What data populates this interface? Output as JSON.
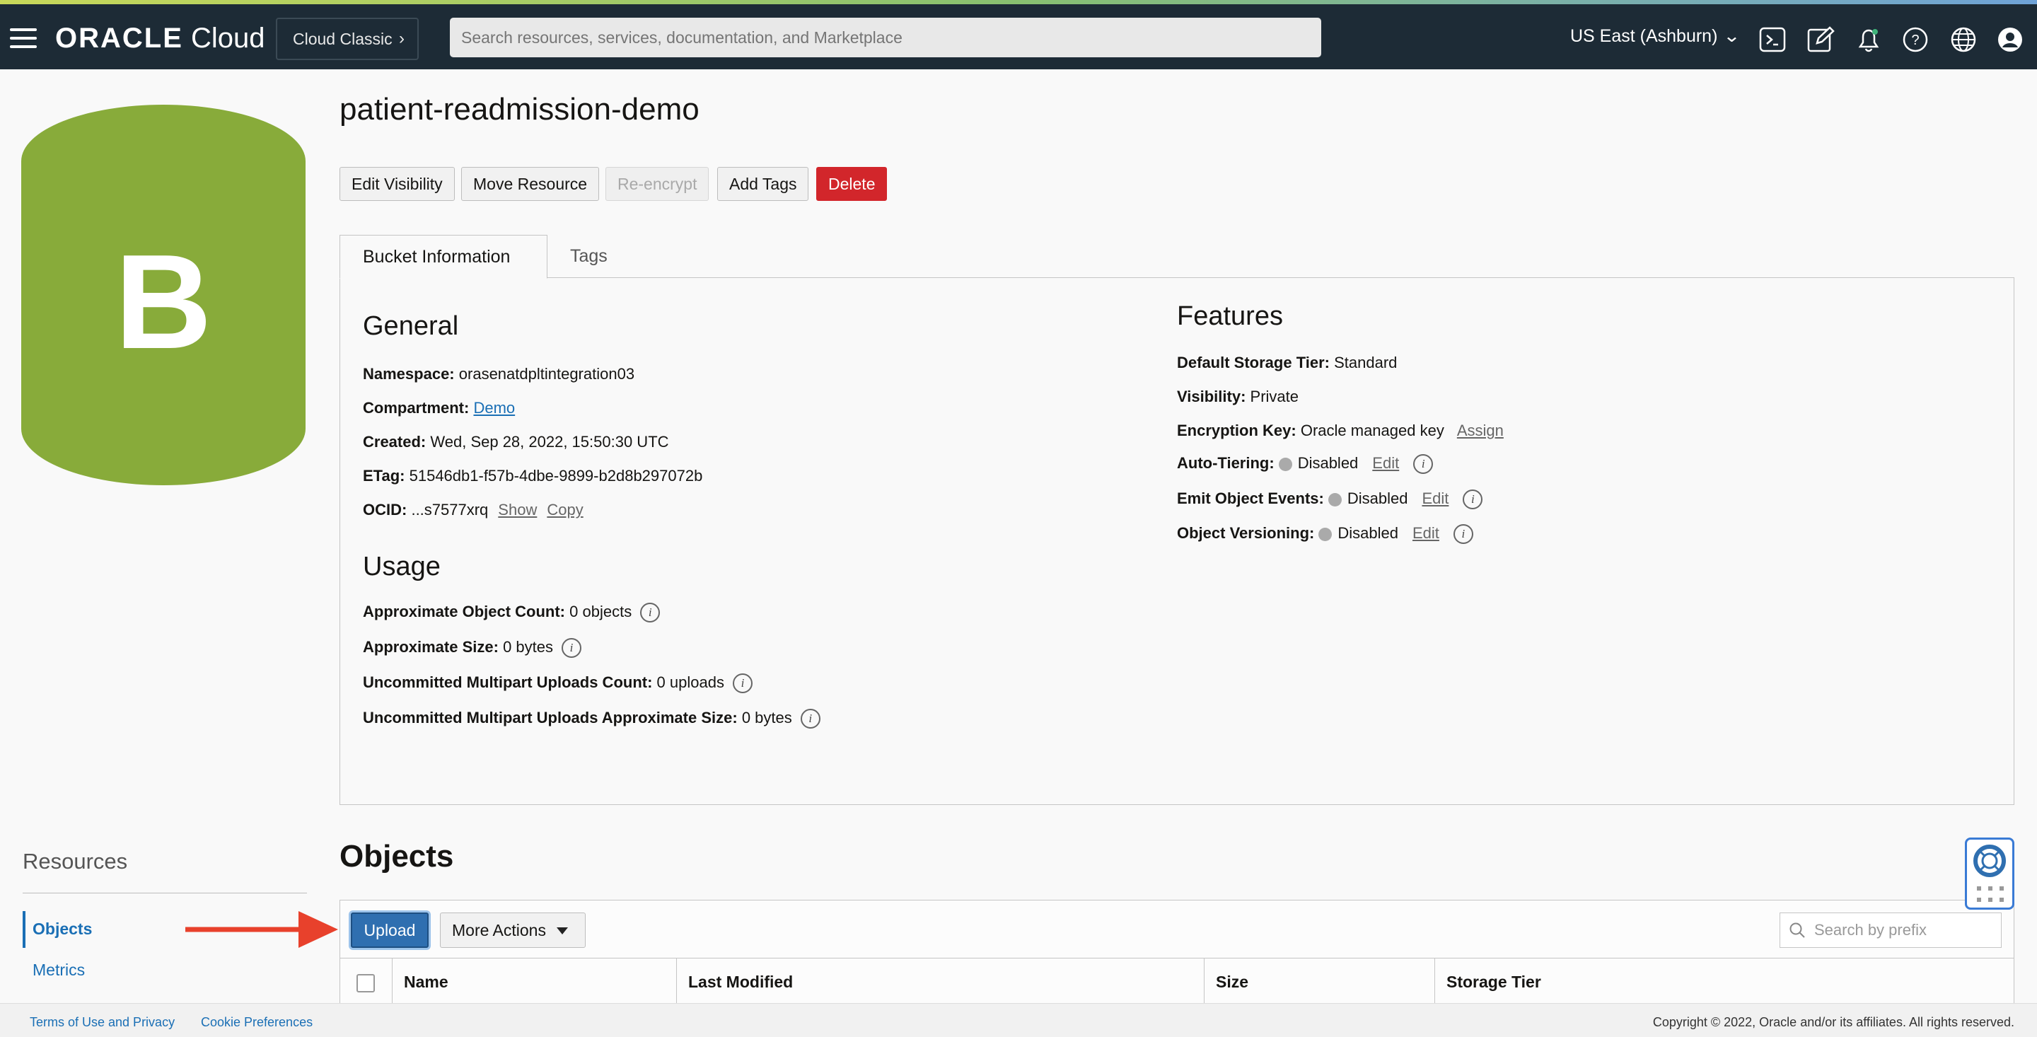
{
  "topbar": {
    "logo_brand": "ORACLE",
    "logo_product": "Cloud",
    "classic_label": "Cloud Classic",
    "search_placeholder": "Search resources, services, documentation, and Marketplace",
    "region": "US East (Ashburn)",
    "icons": [
      "cloud-shell-icon",
      "edit-icon",
      "bell-icon",
      "help-icon",
      "globe-icon",
      "user-icon"
    ]
  },
  "bucket": {
    "logo_letter": "B",
    "logo_color": "#88ab3a",
    "title": "patient-readmission-demo"
  },
  "actions": {
    "edit_visibility": "Edit Visibility",
    "move_resource": "Move Resource",
    "reencrypt": "Re-encrypt",
    "add_tags": "Add Tags",
    "delete": "Delete"
  },
  "tabs": {
    "bucket_info": "Bucket Information",
    "tags": "Tags"
  },
  "general": {
    "heading": "General",
    "namespace_k": "Namespace:",
    "namespace_v": "orasenatdpltintegration03",
    "compartment_k": "Compartment:",
    "compartment_v": "Demo",
    "created_k": "Created:",
    "created_v": "Wed, Sep 28, 2022, 15:50:30 UTC",
    "etag_k": "ETag:",
    "etag_v": "51546db1-f57b-4dbe-9899-b2d8b297072b",
    "ocid_k": "OCID:",
    "ocid_v": "...s7577xrq",
    "show": "Show",
    "copy": "Copy"
  },
  "usage": {
    "heading": "Usage",
    "count_k": "Approximate Object Count:",
    "count_v": "0 objects",
    "size_k": "Approximate Size:",
    "size_v": "0 bytes",
    "mp_count_k": "Uncommitted Multipart Uploads Count:",
    "mp_count_v": "0 uploads",
    "mp_size_k": "Uncommitted Multipart Uploads Approximate Size:",
    "mp_size_v": "0 bytes"
  },
  "features": {
    "heading": "Features",
    "tier_k": "Default Storage Tier:",
    "tier_v": "Standard",
    "visibility_k": "Visibility:",
    "visibility_v": "Private",
    "enc_k": "Encryption Key:",
    "enc_v": "Oracle managed key",
    "assign": "Assign",
    "autotier_k": "Auto-Tiering:",
    "autotier_v": "Disabled",
    "events_k": "Emit Object Events:",
    "events_v": "Disabled",
    "versioning_k": "Object Versioning:",
    "versioning_v": "Disabled",
    "edit": "Edit"
  },
  "resources": {
    "heading": "Resources",
    "objects": "Objects",
    "metrics": "Metrics"
  },
  "objects": {
    "heading": "Objects",
    "upload": "Upload",
    "more_actions": "More Actions",
    "search_placeholder": "Search by prefix",
    "columns": [
      "Name",
      "Last Modified",
      "Size",
      "Storage Tier"
    ]
  },
  "footer": {
    "terms": "Terms of Use and Privacy",
    "cookies": "Cookie Preferences",
    "copyright": "Copyright © 2022, Oracle and/or its affiliates. All rights reserved."
  }
}
